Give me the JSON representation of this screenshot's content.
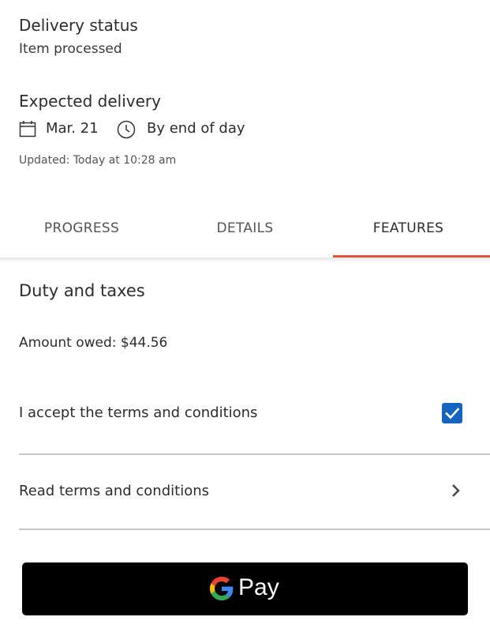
{
  "delivery": {
    "status_label": "Delivery status",
    "status_value": "Item processed",
    "expected_label": "Expected delivery",
    "date": "Mar. 21",
    "time": "By end of day",
    "updated": "Updated: Today at 10:28 am"
  },
  "tabs": [
    {
      "label": "PROGRESS",
      "active": false
    },
    {
      "label": "DETAILS",
      "active": false
    },
    {
      "label": "FEATURES",
      "active": true
    }
  ],
  "features": {
    "title": "Duty and taxes",
    "amount_owed": "Amount owed: $44.56",
    "accept_terms": "I accept the terms and conditions",
    "accept_checked": true,
    "read_terms": "Read terms and conditions"
  },
  "pay_button": {
    "label": "Pay",
    "brand": "Google Pay"
  },
  "icons": {
    "calendar": "calendar-icon",
    "clock": "clock-icon",
    "checkbox": "checkbox-checked-icon",
    "chevron": "chevron-right-icon",
    "google": "google-g-logo"
  },
  "colors": {
    "accent_underline": "#e0533e",
    "checkbox": "#1565c0",
    "pay_button_bg": "#000000",
    "pay_button_text": "#ffffff",
    "divider": "#c8c8c8"
  }
}
